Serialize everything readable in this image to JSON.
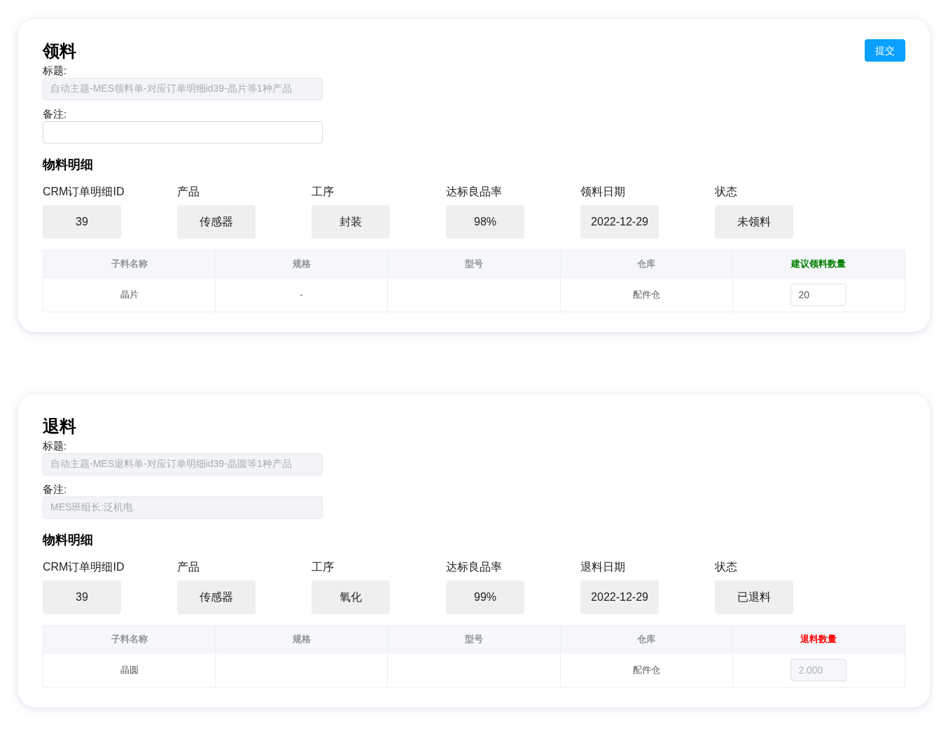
{
  "sections": [
    {
      "heading": "领料",
      "submit_button": "提交",
      "fields": [
        {
          "label": "标题:",
          "value": "自动主题-MES领料单-对应订单明细id39-晶片等1种产品",
          "disabled": true
        },
        {
          "label": "备注:",
          "disabled": false
        }
      ],
      "detail_heading": "物料明细",
      "info": [
        {
          "label": "CRM订单明细ID",
          "value": "39"
        },
        {
          "label": "产品",
          "value": "传感器"
        },
        {
          "label": "工序",
          "value": "封装"
        },
        {
          "label": "达标良品率",
          "value": "98%"
        },
        {
          "label": "领料日期",
          "value": "2022-12-29"
        },
        {
          "label": "状态",
          "value": "未领料"
        }
      ],
      "table": {
        "columns": [
          {
            "label": "子料名称"
          },
          {
            "label": "规格"
          },
          {
            "label": "型号"
          },
          {
            "label": "仓库"
          },
          {
            "label": "建议领料数量",
            "color": "#008000"
          }
        ],
        "rows": [
          {
            "name": "晶片",
            "spec": "-",
            "warehouse": "配件仓",
            "quantity": {
              "value": "20",
              "disabled": false
            }
          }
        ]
      }
    },
    {
      "heading": "退料",
      "fields": [
        {
          "label": "标题:",
          "value": "自动主题-MES退料单-对应订单明细id39-晶圆等1种产品",
          "disabled": true
        },
        {
          "label": "备注:",
          "value": "MES班组长:泛机电",
          "disabled": true
        }
      ],
      "detail_heading": "物料明细",
      "info": [
        {
          "label": "CRM订单明细ID",
          "value": "39"
        },
        {
          "label": "产品",
          "value": "传感器"
        },
        {
          "label": "工序",
          "value": "氧化"
        },
        {
          "label": "达标良品率",
          "value": "99%"
        },
        {
          "label": "退料日期",
          "value": "2022-12-29"
        },
        {
          "label": "状态",
          "value": "已退料"
        }
      ],
      "table": {
        "columns": [
          {
            "label": "子料名称"
          },
          {
            "label": "规格"
          },
          {
            "label": "型号"
          },
          {
            "label": "仓库"
          },
          {
            "label": "退料数量",
            "color": "#ff0000"
          }
        ],
        "rows": [
          {
            "name": "晶圆",
            "warehouse": "配件仓",
            "quantity": {
              "value": "2.000",
              "disabled": true
            }
          }
        ]
      }
    }
  ]
}
